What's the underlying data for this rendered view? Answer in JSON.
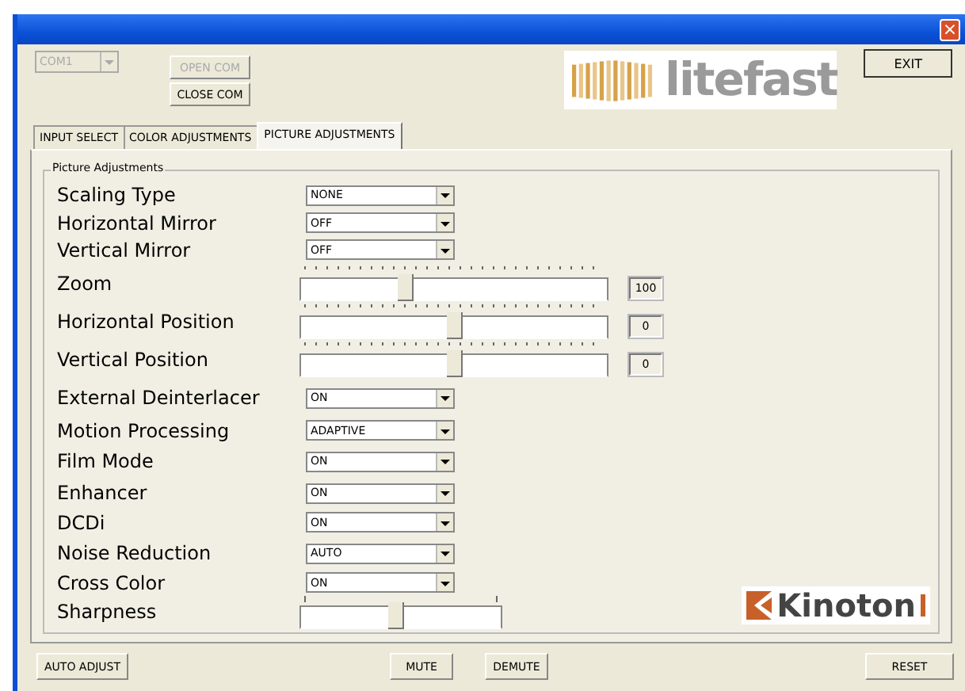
{
  "window": {
    "close": "×"
  },
  "com": {
    "port": "COM1",
    "disabled": true,
    "buttons": [
      {
        "label": "OPEN COM",
        "disabled": true
      },
      {
        "label": "CLOSE COM",
        "disabled": false
      }
    ]
  },
  "logo": "litefast",
  "exit": "EXIT",
  "tabs": [
    {
      "label": "INPUT SELECT",
      "selected": false
    },
    {
      "label": "COLOR ADJUSTMENTS",
      "selected": false
    },
    {
      "label": "PICTURE ADJUSTMENTS",
      "selected": true
    }
  ],
  "group": {
    "title": "Picture Adjustments",
    "rows": [
      {
        "kind": "dropdown",
        "label": "Scaling Type",
        "value": "NONE"
      },
      {
        "kind": "dropdown",
        "label": "Horizontal Mirror",
        "value": "OFF"
      },
      {
        "kind": "dropdown",
        "label": "Vertical Mirror",
        "value": "OFF"
      },
      {
        "kind": "slider",
        "label": "Zoom",
        "level": 0.34,
        "reading": "100"
      },
      {
        "kind": "slider",
        "label": "Horizontal Position",
        "level": 0.5,
        "reading": "0"
      },
      {
        "kind": "slider",
        "label": "Vertical Position",
        "level": 0.5,
        "reading": "0"
      },
      {
        "kind": "dropdown",
        "label": "External Deinterlacer",
        "value": "ON"
      },
      {
        "kind": "dropdown",
        "label": "Motion Processing",
        "value": "ADAPTIVE"
      },
      {
        "kind": "dropdown",
        "label": "Film Mode",
        "value": "ON"
      },
      {
        "kind": "dropdown",
        "label": "Enhancer",
        "value": "ON"
      },
      {
        "kind": "dropdown",
        "label": "DCDi",
        "value": "ON"
      },
      {
        "kind": "dropdown",
        "label": "Noise Reduction",
        "value": "AUTO"
      },
      {
        "kind": "dropdown",
        "label": "Cross Color",
        "value": "ON"
      },
      {
        "kind": "short-slider",
        "label": "Sharpness",
        "level": 0.48
      }
    ]
  },
  "brand": "Kinoton",
  "bottom_buttons": [
    "AUTO ADJUST",
    "MUTE",
    "DEMUTE",
    "RESET"
  ]
}
